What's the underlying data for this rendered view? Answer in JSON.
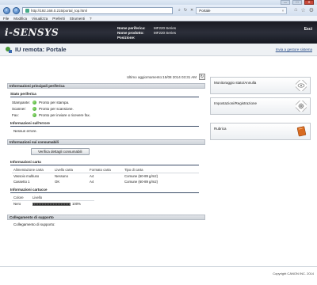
{
  "browser": {
    "address": "http://192.168.0.215/portal_top.html",
    "tab_title": "Portale",
    "menu": [
      "File",
      "Modifica",
      "Visualizza",
      "Preferiti",
      "Strumenti",
      "?"
    ],
    "win_min": "—",
    "win_max": "□",
    "win_close": "✕"
  },
  "header": {
    "logo": "i-SENSYS",
    "device_name_label": "Nome periferica:",
    "device_name_value": "MF220 Series",
    "product_name_label": "Nome prodotto:",
    "product_name_value": "MF220 Series",
    "position_label": "Posizione:",
    "position_value": "",
    "logout": "Esci"
  },
  "page": {
    "title": "IU remota: Portale",
    "send_link": "Invia a gestore sistema",
    "last_update": "Ultimo aggiornamento:15/08 2014 03:31 AM"
  },
  "main_info": {
    "heading": "Informazioni principali periferica",
    "status_heading": "Stato periferica",
    "status": [
      {
        "label": "Stampante:",
        "text": "Pronto per stampa."
      },
      {
        "label": "Scanner:",
        "text": "Pronto per scansione."
      },
      {
        "label": "Fax:",
        "text": "Pronto per inviare o ricevere fax."
      }
    ],
    "error_heading": "Informazioni sull'errore",
    "error_text": "Nessun errore."
  },
  "consumables": {
    "heading": "Informazioni sui consumabili",
    "button": "Verifica dettagli consumabili",
    "paper_heading": "Informazioni carta",
    "paper_columns": [
      "Alimentazione carta",
      "Livello carta",
      "Formato carta",
      "Tipo di carta"
    ],
    "paper_rows": [
      [
        "Vassoio multiuso",
        "Nessuno",
        "A4",
        "Comune (60-89 g/m2)"
      ],
      [
        "Cassetto 1",
        "OK",
        "A4",
        "Comune (60-89 g/m2)"
      ]
    ],
    "cartridge_heading": "Informazioni cartucce",
    "cartridge_columns": [
      "Colore",
      "Livello"
    ],
    "cartridge_color": "Nero",
    "cartridge_level": 100,
    "cartridge_level_text": "100%"
  },
  "support": {
    "heading": "Collegamento di supporto",
    "text": "Collegamento di supporto:"
  },
  "side": {
    "monitor": "Monitoraggio stato/Annulla",
    "settings": "Impostazioni/Registrazione",
    "address_book": "Rubrica"
  },
  "footer": {
    "copyright": "Copyright CANON INC. 2014"
  }
}
